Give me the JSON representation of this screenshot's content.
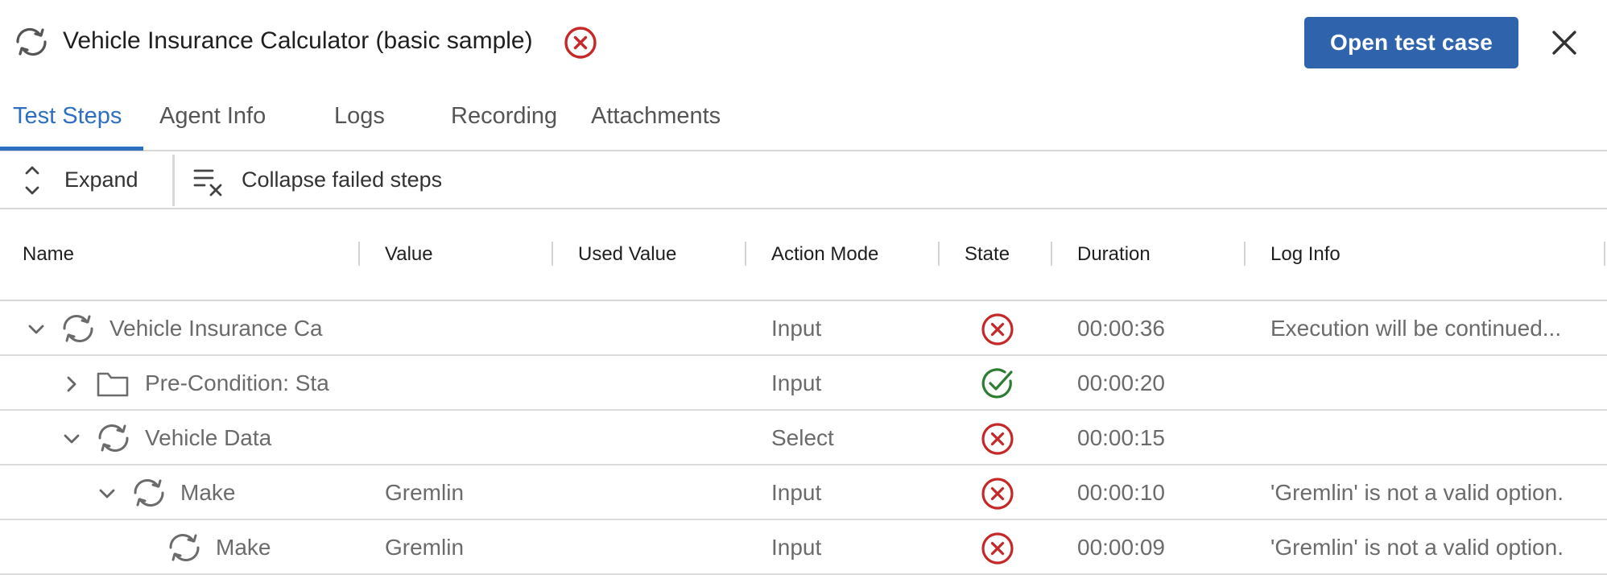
{
  "header": {
    "title": "Vehicle Insurance Calculator (basic sample)",
    "status": "failed",
    "open_button": "Open test case",
    "close_icon": "close-icon"
  },
  "tabs": [
    {
      "label": "Test Steps",
      "active": true
    },
    {
      "label": "Agent Info",
      "active": false
    },
    {
      "label": "Logs",
      "active": false
    },
    {
      "label": "Recording",
      "active": false
    },
    {
      "label": "Attachments",
      "active": false
    }
  ],
  "toolbar": {
    "expand_label": "Expand",
    "collapse_label": "Collapse failed steps"
  },
  "table": {
    "columns": [
      "Name",
      "Value",
      "Used Value",
      "Action Mode",
      "State",
      "Duration",
      "Log Info"
    ],
    "rows": [
      {
        "toggle": "expanded",
        "icon": "sync-icon",
        "name": "Vehicle Insurance Ca",
        "value": "",
        "used_value": "",
        "action_mode": "Input",
        "state": "failed",
        "duration": "00:00:36",
        "log_info": "Execution will be continued..."
      },
      {
        "toggle": "collapsed",
        "icon": "folder-icon",
        "name": "Pre-Condition: Sta",
        "value": "",
        "used_value": "",
        "action_mode": "Input",
        "state": "passed",
        "duration": "00:00:20",
        "log_info": ""
      },
      {
        "toggle": "expanded",
        "icon": "sync-icon",
        "name": "Vehicle Data",
        "value": "",
        "used_value": "",
        "action_mode": "Select",
        "state": "failed",
        "duration": "00:00:15",
        "log_info": ""
      },
      {
        "toggle": "expanded",
        "icon": "sync-icon",
        "name": "Make",
        "value": "Gremlin",
        "used_value": "",
        "action_mode": "Input",
        "state": "failed",
        "duration": "00:00:10",
        "log_info": "'Gremlin' is not a valid option."
      },
      {
        "toggle": "none",
        "icon": "sync-icon",
        "name": "Make",
        "value": "Gremlin",
        "used_value": "",
        "action_mode": "Input",
        "state": "failed",
        "duration": "00:00:09",
        "log_info": "'Gremlin' is not a valid option."
      }
    ]
  },
  "colors": {
    "primary": "#2f64ad",
    "tab_active": "#2f6fc0",
    "failed": "#c62828",
    "passed": "#2e7d32"
  }
}
